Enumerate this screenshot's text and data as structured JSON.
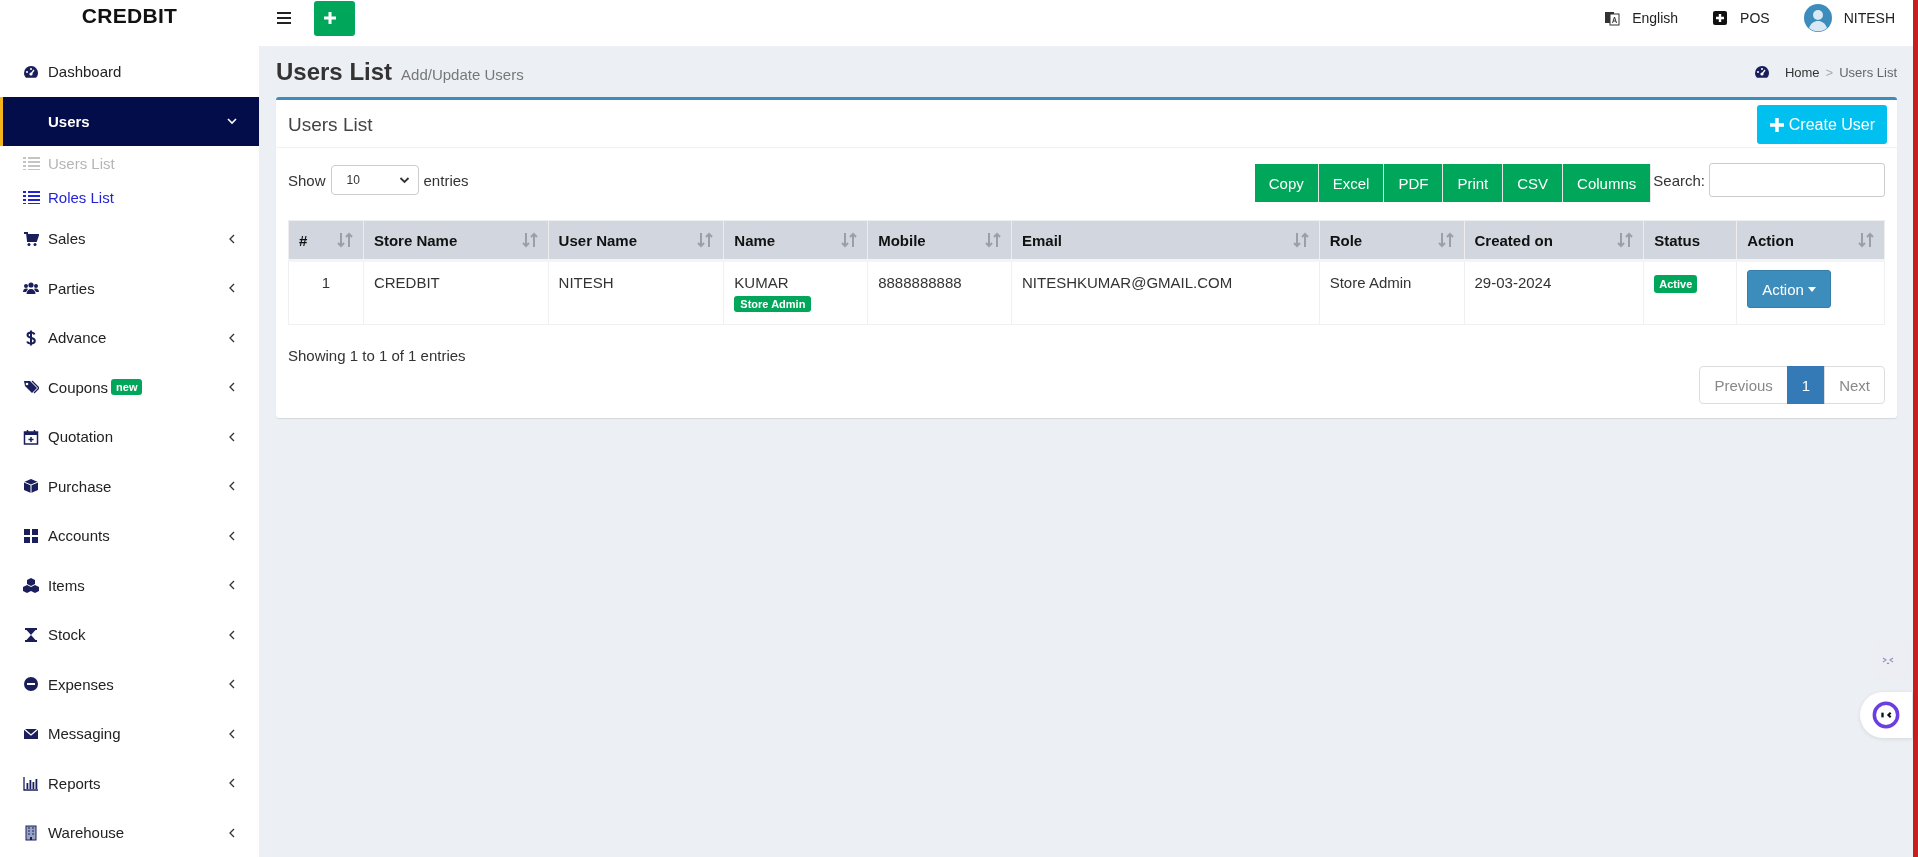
{
  "topbar": {
    "brand": "CREDBIT",
    "language": "English",
    "pos": "POS",
    "user": "NITESH"
  },
  "sidebar": {
    "items": [
      {
        "label": "Dashboard",
        "selected": false,
        "expandable": false
      },
      {
        "label": "Users",
        "selected": true,
        "expanded": true,
        "children": [
          {
            "label": "Users List",
            "selected": true
          },
          {
            "label": "Roles List",
            "selected": false
          }
        ]
      },
      {
        "label": "Sales",
        "selected": false,
        "expanded": false
      },
      {
        "label": "Parties",
        "selected": false,
        "expanded": false
      },
      {
        "label": "Advance",
        "selected": false,
        "expanded": false
      },
      {
        "label": "Coupons",
        "selected": false,
        "expanded": false,
        "badge": "new"
      },
      {
        "label": "Quotation",
        "selected": false,
        "expanded": false
      },
      {
        "label": "Purchase",
        "selected": false,
        "expanded": false
      },
      {
        "label": "Accounts",
        "selected": false,
        "expanded": false
      },
      {
        "label": "Items",
        "selected": false,
        "expanded": false
      },
      {
        "label": "Stock",
        "selected": false,
        "expanded": false
      },
      {
        "label": "Expenses",
        "selected": false,
        "expanded": false
      },
      {
        "label": "Messaging",
        "selected": false,
        "expanded": false
      },
      {
        "label": "Reports",
        "selected": false,
        "expanded": false
      },
      {
        "label": "Warehouse",
        "selected": false,
        "expanded": false
      }
    ]
  },
  "page": {
    "title": "Users List",
    "subtitle": "Add/Update Users",
    "breadcrumb": [
      "Home",
      "Users List"
    ],
    "breadcrumb_separator": ">"
  },
  "card": {
    "title": "Users List",
    "create_button": "Create User",
    "length": {
      "before": "Show",
      "value": "10",
      "after": "entries"
    },
    "export_buttons": [
      "Copy",
      "Excel",
      "PDF",
      "Print",
      "CSV",
      "Columns"
    ],
    "search_label": "Search:",
    "table": {
      "columns": [
        {
          "label": "#",
          "sortable": true
        },
        {
          "label": "Store Name",
          "sortable": true
        },
        {
          "label": "User Name",
          "sortable": true
        },
        {
          "label": "Name",
          "sortable": true
        },
        {
          "label": "Mobile",
          "sortable": true
        },
        {
          "label": "Email",
          "sortable": true
        },
        {
          "label": "Role",
          "sortable": true
        },
        {
          "label": "Created on",
          "sortable": true
        },
        {
          "label": "Status",
          "sortable": false
        },
        {
          "label": "Action",
          "sortable": true
        }
      ],
      "rows": [
        {
          "number": "1",
          "store_name": "CREDBIT",
          "user_name": "NITESH",
          "name": "KUMAR",
          "name_badge": "Store Admin",
          "mobile": "8888888888",
          "email": "NITESHKUMAR@GMAIL.COM",
          "role": "Store Admin",
          "created_on": "29-03-2024",
          "status": "Active",
          "action": "Action"
        }
      ]
    },
    "info": "Showing 1 to 1 of 1 entries",
    "pagination": [
      {
        "label": "Previous",
        "selected": false,
        "disabled": true
      },
      {
        "label": "1",
        "selected": true,
        "disabled": false
      },
      {
        "label": "Next",
        "selected": false,
        "disabled": true
      }
    ]
  }
}
